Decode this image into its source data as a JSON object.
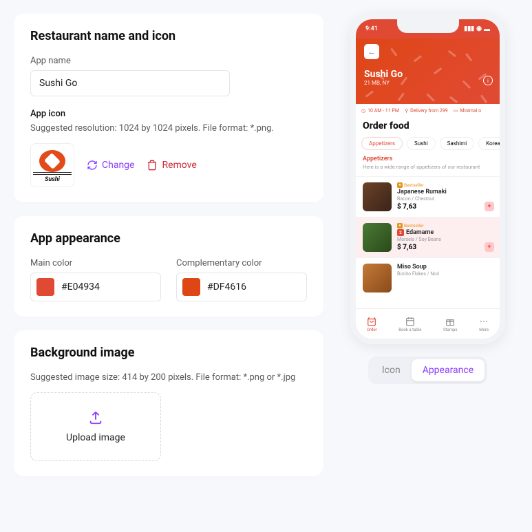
{
  "section1": {
    "title": "Restaurant name and icon",
    "app_name_label": "App name",
    "app_name_value": "Sushi Go",
    "icon_label": "App icon",
    "icon_hint": "Suggested resolution: 1024 by 1024 pixels. File format: *.png.",
    "icon_text": "Sushi",
    "change_label": "Change",
    "remove_label": "Remove"
  },
  "section2": {
    "title": "App appearance",
    "main_color_label": "Main color",
    "main_color_value": "#E04934",
    "comp_color_label": "Complementary color",
    "comp_color_value": "#DF4616"
  },
  "section3": {
    "title": "Background image",
    "hint": "Suggested image size: 414 by 200 pixels. File format: *.png or *.jpg",
    "upload_label": "Upload image"
  },
  "phone": {
    "time": "9:41",
    "restaurant": "Sushi Go",
    "location": "21 MB, NY",
    "hours": "10 AM - 11 PM",
    "delivery": "Delivery from 299",
    "minimal": "Minimal o",
    "order_title": "Order food",
    "chips": [
      "Appetizers",
      "Sushi",
      "Sashimi",
      "Korean fo"
    ],
    "cat_title": "Appetizers",
    "cat_sub": "Here is a wide range of appetizers of our restaurant",
    "bestseller": "Bestseller",
    "items": [
      {
        "name": "Japanese Rumaki",
        "desc": "Bacon / Chestnut",
        "price": "$ 7,63",
        "img": "#5a3a28"
      },
      {
        "name": "Edamame",
        "desc": "Morsels / Soy Beans",
        "price": "$ 7,63",
        "qty": "2",
        "img": "#3a6b2a"
      },
      {
        "name": "Miso Soup",
        "desc": "Bonito Flakes / Nori",
        "price": "",
        "img": "#a8632a"
      }
    ],
    "tabs": [
      "Order",
      "Book a table",
      "Stamps",
      "More"
    ]
  },
  "toggle": {
    "icon": "Icon",
    "appearance": "Appearance"
  }
}
